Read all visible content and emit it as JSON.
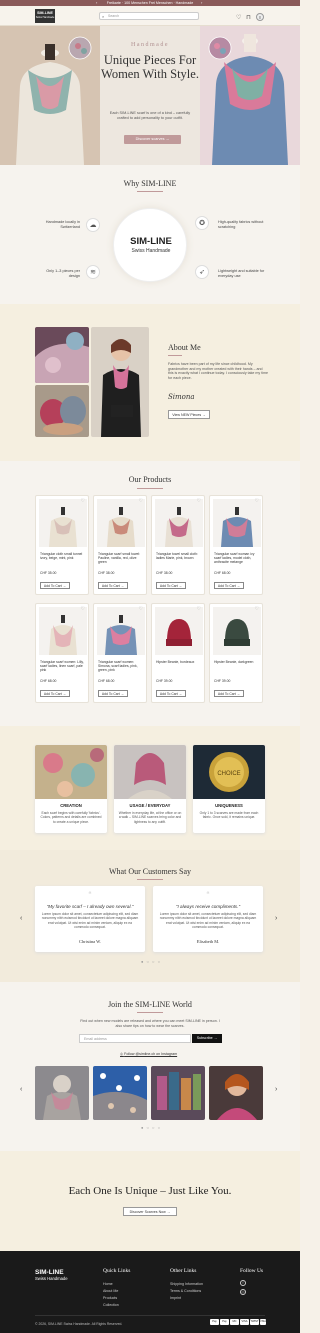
{
  "topbar": {
    "text": "Freikarte · 100 Menschen Frei Menschen · Handmade"
  },
  "header": {
    "logo_line1": "SIM-LINE",
    "logo_line2": "Swiss Handmade",
    "search_placeholder": "Search"
  },
  "hero": {
    "kicker": "Handmade",
    "title": "Unique Pieces For Women With Style.",
    "text": "Each SIM-LINE scarf is one of a kind – carefully crafted to add personality to your outfit.",
    "button": "Discover scarves"
  },
  "why": {
    "title": "Why SIM-LINE",
    "center_title": "SIM-LINE",
    "center_sub": "Swiss Handmade",
    "features": [
      "Handmade locally in Switzerland",
      "High-quality fabrics without scratching",
      "Only 1–3 pieces per design",
      "Lightweight and suitable for everyday use"
    ]
  },
  "about": {
    "title": "About Me",
    "text": "Fabrics have been part of my life since childhood. My grandmother and my mother created with their hands – and this is exactly what I continue today. I consciously take my time for each piece.",
    "signature": "Simona",
    "button": "View NEW Pieces"
  },
  "products": {
    "title": "Our Products",
    "items": [
      {
        "name": "Triangular cloth small tunnel ivory, beige, mint, pink",
        "price": "CHF 35.00"
      },
      {
        "name": "Triangular scarf small towel: Pauline, vanilla, red, olive green",
        "price": "CHF 38.00"
      },
      {
        "name": "Triangular towel small cloth: ladies Marie, pink, brown",
        "price": "CHF 38.00"
      },
      {
        "name": "Triangular scarf woman ivy scarf ladies, model cloth, anthracite melange",
        "price": "CHF 68.00"
      },
      {
        "name": "Triangular scarf women: Lilly, scarf ladies, linen scarf, pale pink",
        "price": "CHF 68.00"
      },
      {
        "name": "Triangular scarf women: Simona, scarf ladies, pink, green, pink",
        "price": "CHF 68.00"
      },
      {
        "name": "Hipster Beanie, bordeaux",
        "price": "CHF 39.00"
      },
      {
        "name": "Hipster Beanie, darkgreen",
        "price": "CHF 39.00"
      }
    ],
    "add_label": "Add To Cart"
  },
  "values": [
    {
      "title": "CREATION",
      "text": "Each scarf begins with carefully 'fabrics'. Colors, patterns and details are combined to create a unique piece."
    },
    {
      "title": "USAGE / EVERYDAY",
      "text": "Whether in everyday life, at the office or on a walk – SIM-LINE scarves bring color and lightness to any outfit."
    },
    {
      "title": "UNIQUENESS",
      "text": "Only 1 to 3 scarves are made from each fabric. Once sold, it remains unique."
    }
  ],
  "values_badge": "CHOICE",
  "testimonials": {
    "title": "What Our Customers Say",
    "items": [
      {
        "headline": "\"My favorite scarf – I already own several.\"",
        "body": "Lorem ipsum dolor sit amet, consectetuer adipiscing elit, sed diam nonummy nibh euismod tincidunt ut laoreet dolore magna aliquam erat volutpat. Ut wisi enim ad minim veniam, aliquip ex ea commodo consequat.",
        "author": "Christina W."
      },
      {
        "headline": "\"I always receive compliments.\"",
        "body": "Lorem ipsum dolor sit amet, consectetuer adipiscing elit, sed diam nonummy nibh euismod tincidunt ut laoreet dolore magna aliquam erat volutpat. Ut wisi enim ad minim veniam, aliquip ex ea commodo consequat.",
        "author": "Elisabeth M."
      }
    ]
  },
  "join": {
    "title": "Join the SIM-LINE World",
    "text": "Find out when new models are released and where you can meet SIM-LINE in person. I also share tips on how to wear the scarves.",
    "email_placeholder": "Email address",
    "subscribe": "Subscribe",
    "follow": "Follow @simline.ch on Instagram"
  },
  "cta": {
    "title": "Each One Is Unique – Just Like You.",
    "button": "Discover Scarves Now"
  },
  "footer": {
    "brand1": "SIM-LINE",
    "brand2": "Swiss Handmade",
    "quick_title": "Quick Links",
    "quick": [
      "Home",
      "About Me",
      "Products",
      "Collection"
    ],
    "other_title": "Other Links",
    "other": [
      "Shipping Information",
      "Terms & Conditions",
      "Imprint"
    ],
    "follow_title": "Follow Us",
    "copyright": "© 2026, SIM-LINE Swiss Handmade. All Rights Reserved.",
    "payments": [
      "Pay",
      "Pay",
      "MC",
      "VISA",
      "TWINT",
      "VISA"
    ]
  },
  "colors": {
    "accent": "#c09a9a",
    "topbar": "#8a5a5a",
    "dark": "#1a1a1a"
  }
}
